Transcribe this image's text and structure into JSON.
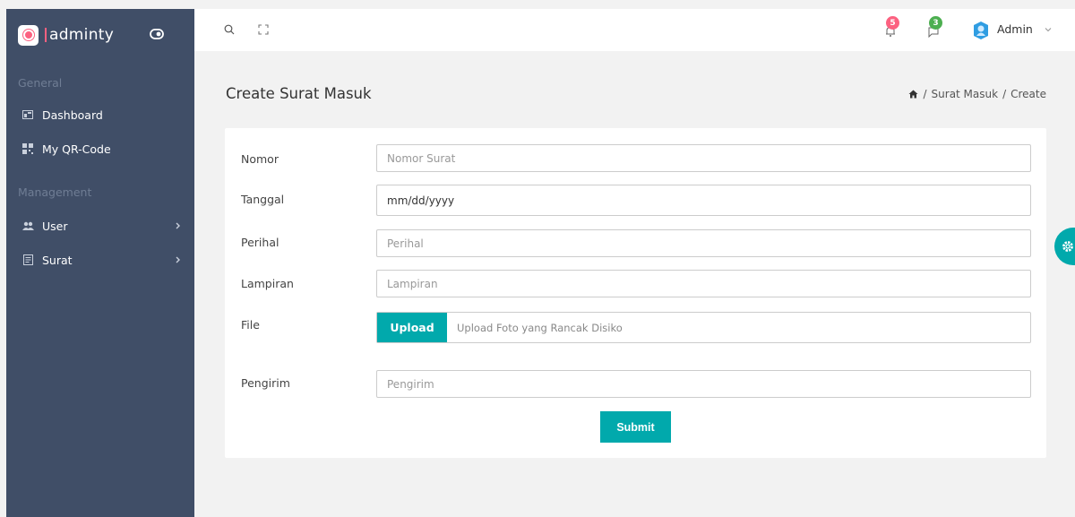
{
  "brand": {
    "name": "adminty"
  },
  "sidebar": {
    "captions": [
      "General",
      "Management"
    ],
    "items": [
      {
        "label": "Dashboard",
        "icon": "dashboard-icon"
      },
      {
        "label": "My QR-Code",
        "icon": "qrcode-icon"
      },
      {
        "label": "User",
        "icon": "users-icon",
        "has_submenu": true
      },
      {
        "label": "Surat",
        "icon": "mail-icon",
        "has_submenu": true
      }
    ]
  },
  "topbar": {
    "notifications_count": "5",
    "messages_count": "3",
    "user_name": "Admin"
  },
  "page": {
    "title": "Create Surat Masuk",
    "breadcrumb": [
      "Surat Masuk",
      "Create"
    ]
  },
  "form": {
    "nomor": {
      "label": "Nomor",
      "placeholder": "Nomor Surat"
    },
    "tanggal": {
      "label": "Tanggal",
      "value": "mm/dd/yyyy"
    },
    "perihal": {
      "label": "Perihal",
      "placeholder": "Perihal"
    },
    "lampiran": {
      "label": "Lampiran",
      "placeholder": "Lampiran"
    },
    "file": {
      "label": "File",
      "button": "Upload",
      "hint": "Upload Foto yang Rancak Disiko"
    },
    "pengirim": {
      "label": "Pengirim",
      "placeholder": "Pengirim"
    },
    "submit": "Submit"
  },
  "colors": {
    "sidebar": "#404e67",
    "accent": "#01a9ac",
    "badge_red": "#fc6180",
    "badge_green": "#4caf50"
  }
}
